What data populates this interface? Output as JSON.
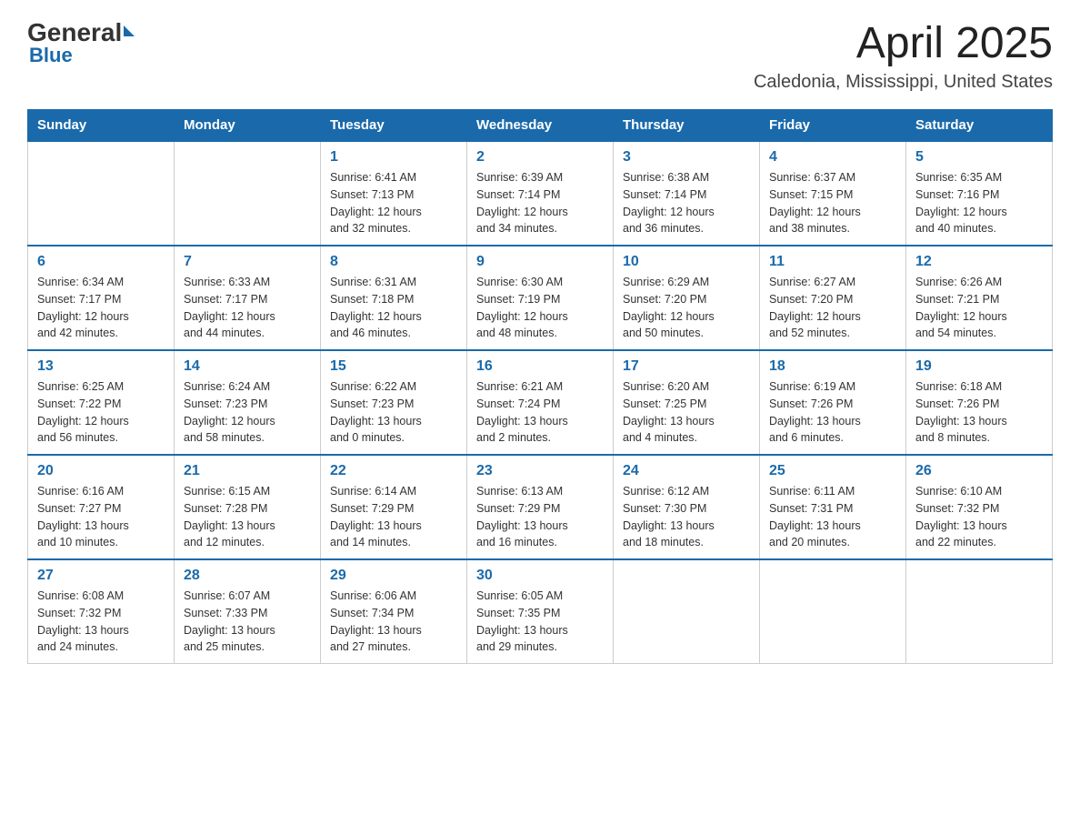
{
  "header": {
    "logo_general": "General",
    "logo_blue": "Blue",
    "month_year": "April 2025",
    "location": "Caledonia, Mississippi, United States"
  },
  "days_of_week": [
    "Sunday",
    "Monday",
    "Tuesday",
    "Wednesday",
    "Thursday",
    "Friday",
    "Saturday"
  ],
  "weeks": [
    [
      {
        "day": "",
        "info": ""
      },
      {
        "day": "",
        "info": ""
      },
      {
        "day": "1",
        "info": "Sunrise: 6:41 AM\nSunset: 7:13 PM\nDaylight: 12 hours\nand 32 minutes."
      },
      {
        "day": "2",
        "info": "Sunrise: 6:39 AM\nSunset: 7:14 PM\nDaylight: 12 hours\nand 34 minutes."
      },
      {
        "day": "3",
        "info": "Sunrise: 6:38 AM\nSunset: 7:14 PM\nDaylight: 12 hours\nand 36 minutes."
      },
      {
        "day": "4",
        "info": "Sunrise: 6:37 AM\nSunset: 7:15 PM\nDaylight: 12 hours\nand 38 minutes."
      },
      {
        "day": "5",
        "info": "Sunrise: 6:35 AM\nSunset: 7:16 PM\nDaylight: 12 hours\nand 40 minutes."
      }
    ],
    [
      {
        "day": "6",
        "info": "Sunrise: 6:34 AM\nSunset: 7:17 PM\nDaylight: 12 hours\nand 42 minutes."
      },
      {
        "day": "7",
        "info": "Sunrise: 6:33 AM\nSunset: 7:17 PM\nDaylight: 12 hours\nand 44 minutes."
      },
      {
        "day": "8",
        "info": "Sunrise: 6:31 AM\nSunset: 7:18 PM\nDaylight: 12 hours\nand 46 minutes."
      },
      {
        "day": "9",
        "info": "Sunrise: 6:30 AM\nSunset: 7:19 PM\nDaylight: 12 hours\nand 48 minutes."
      },
      {
        "day": "10",
        "info": "Sunrise: 6:29 AM\nSunset: 7:20 PM\nDaylight: 12 hours\nand 50 minutes."
      },
      {
        "day": "11",
        "info": "Sunrise: 6:27 AM\nSunset: 7:20 PM\nDaylight: 12 hours\nand 52 minutes."
      },
      {
        "day": "12",
        "info": "Sunrise: 6:26 AM\nSunset: 7:21 PM\nDaylight: 12 hours\nand 54 minutes."
      }
    ],
    [
      {
        "day": "13",
        "info": "Sunrise: 6:25 AM\nSunset: 7:22 PM\nDaylight: 12 hours\nand 56 minutes."
      },
      {
        "day": "14",
        "info": "Sunrise: 6:24 AM\nSunset: 7:23 PM\nDaylight: 12 hours\nand 58 minutes."
      },
      {
        "day": "15",
        "info": "Sunrise: 6:22 AM\nSunset: 7:23 PM\nDaylight: 13 hours\nand 0 minutes."
      },
      {
        "day": "16",
        "info": "Sunrise: 6:21 AM\nSunset: 7:24 PM\nDaylight: 13 hours\nand 2 minutes."
      },
      {
        "day": "17",
        "info": "Sunrise: 6:20 AM\nSunset: 7:25 PM\nDaylight: 13 hours\nand 4 minutes."
      },
      {
        "day": "18",
        "info": "Sunrise: 6:19 AM\nSunset: 7:26 PM\nDaylight: 13 hours\nand 6 minutes."
      },
      {
        "day": "19",
        "info": "Sunrise: 6:18 AM\nSunset: 7:26 PM\nDaylight: 13 hours\nand 8 minutes."
      }
    ],
    [
      {
        "day": "20",
        "info": "Sunrise: 6:16 AM\nSunset: 7:27 PM\nDaylight: 13 hours\nand 10 minutes."
      },
      {
        "day": "21",
        "info": "Sunrise: 6:15 AM\nSunset: 7:28 PM\nDaylight: 13 hours\nand 12 minutes."
      },
      {
        "day": "22",
        "info": "Sunrise: 6:14 AM\nSunset: 7:29 PM\nDaylight: 13 hours\nand 14 minutes."
      },
      {
        "day": "23",
        "info": "Sunrise: 6:13 AM\nSunset: 7:29 PM\nDaylight: 13 hours\nand 16 minutes."
      },
      {
        "day": "24",
        "info": "Sunrise: 6:12 AM\nSunset: 7:30 PM\nDaylight: 13 hours\nand 18 minutes."
      },
      {
        "day": "25",
        "info": "Sunrise: 6:11 AM\nSunset: 7:31 PM\nDaylight: 13 hours\nand 20 minutes."
      },
      {
        "day": "26",
        "info": "Sunrise: 6:10 AM\nSunset: 7:32 PM\nDaylight: 13 hours\nand 22 minutes."
      }
    ],
    [
      {
        "day": "27",
        "info": "Sunrise: 6:08 AM\nSunset: 7:32 PM\nDaylight: 13 hours\nand 24 minutes."
      },
      {
        "day": "28",
        "info": "Sunrise: 6:07 AM\nSunset: 7:33 PM\nDaylight: 13 hours\nand 25 minutes."
      },
      {
        "day": "29",
        "info": "Sunrise: 6:06 AM\nSunset: 7:34 PM\nDaylight: 13 hours\nand 27 minutes."
      },
      {
        "day": "30",
        "info": "Sunrise: 6:05 AM\nSunset: 7:35 PM\nDaylight: 13 hours\nand 29 minutes."
      },
      {
        "day": "",
        "info": ""
      },
      {
        "day": "",
        "info": ""
      },
      {
        "day": "",
        "info": ""
      }
    ]
  ]
}
